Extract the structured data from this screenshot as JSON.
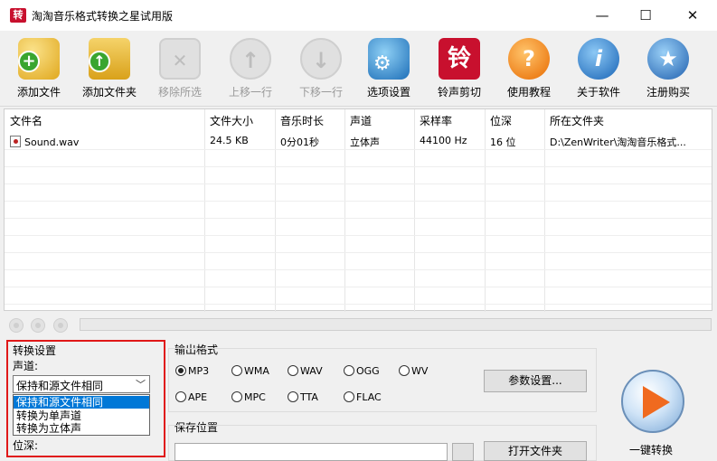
{
  "window": {
    "title": "淘淘音乐格式转换之星试用版",
    "app_icon_char": "转",
    "minimize": "—",
    "maximize": "☐",
    "close": "✕"
  },
  "toolbar": {
    "add_file": "添加文件",
    "add_folder": "添加文件夹",
    "remove_selected": "移除所选",
    "move_up": "上移一行",
    "move_down": "下移一行",
    "options": "选项设置",
    "ringtone": "铃声剪切",
    "ringtone_char": "铃",
    "tutorial": "使用教程",
    "about": "关于软件",
    "register": "注册购买"
  },
  "filelist": {
    "columns": [
      "文件名",
      "文件大小",
      "音乐时长",
      "声道",
      "采样率",
      "位深",
      "所在文件夹"
    ],
    "rows": [
      {
        "name": "Sound.wav",
        "size": "24.5 KB",
        "duration": "0分01秒",
        "channel": "立体声",
        "samplerate": "44100 Hz",
        "bitdepth": "16 位",
        "folder": "D:\\ZenWriter\\淘淘音乐格式..."
      }
    ]
  },
  "convert_settings": {
    "title": "转换设置",
    "channel_label": "声道:",
    "channel_value": "保持和源文件相同",
    "channel_options": [
      "保持和源文件相同",
      "转换为单声道",
      "转换为立体声"
    ],
    "bitdepth_label": "位深:"
  },
  "output": {
    "title": "输出格式",
    "formats": [
      "MP3",
      "WMA",
      "WAV",
      "OGG",
      "WV",
      "APE",
      "MPC",
      "TTA",
      "FLAC"
    ],
    "selected": "MP3",
    "param_button": "参数设置...",
    "save_title": "保存位置",
    "open_folder": "打开文件夹",
    "convert_label": "一键转换"
  },
  "colors": {
    "accent_blue": "#0078d7",
    "highlight_red": "#e01818",
    "ringtone_red": "#c8102e"
  }
}
